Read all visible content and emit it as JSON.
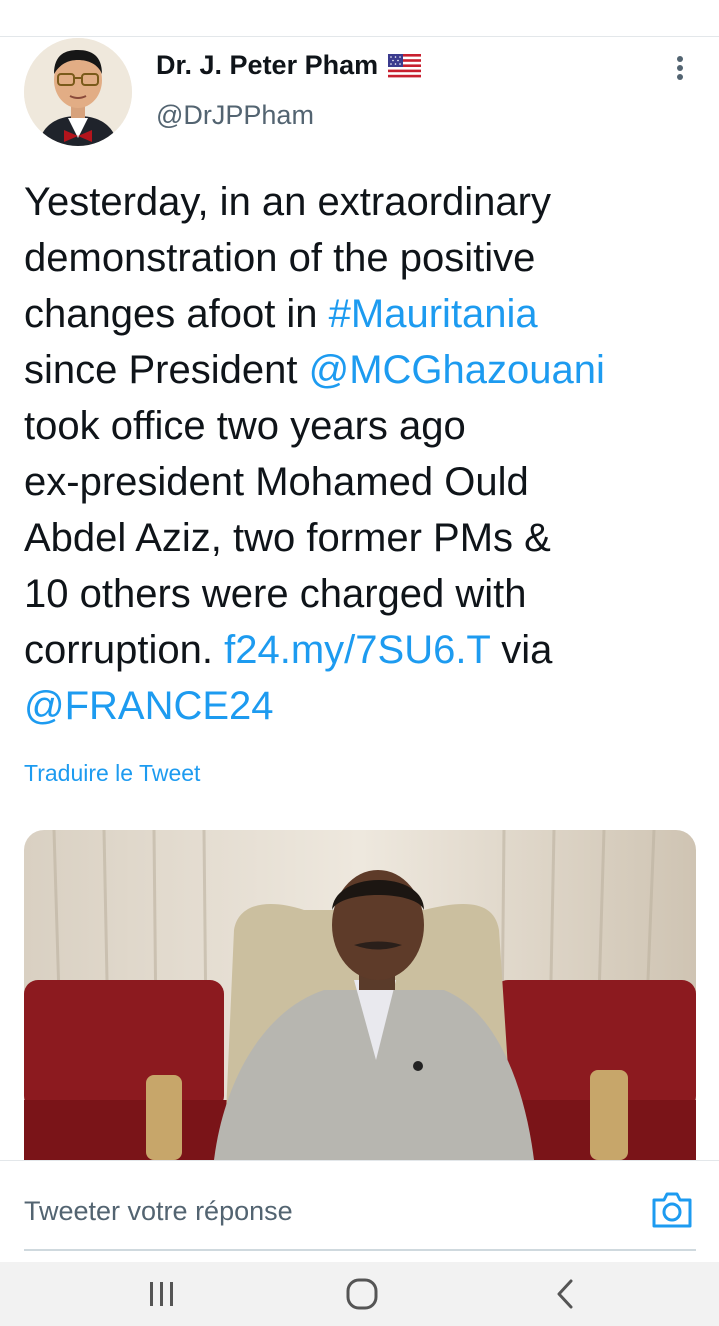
{
  "author": {
    "name": "Dr. J. Peter Pham",
    "handle": "@DrJPPham",
    "flag_icon": "us-flag-icon"
  },
  "tweet": {
    "lines": [
      [
        {
          "t": "Yesterday, in an extraordinary",
          "link": false
        }
      ],
      [
        {
          "t": "demonstration of the positive",
          "link": false
        }
      ],
      [
        {
          "t": "changes afoot in ",
          "link": false
        },
        {
          "t": "#Mauritania",
          "link": true
        }
      ],
      [
        {
          "t": "since President ",
          "link": false
        },
        {
          "t": "@MCGhazouani",
          "link": true
        }
      ],
      [
        {
          "t": "took office two years ago",
          "link": false
        }
      ],
      [
        {
          "t": "ex-president Mohamed Ould",
          "link": false
        }
      ],
      [
        {
          "t": "Abdel Aziz, two former PMs &",
          "link": false
        }
      ],
      [
        {
          "t": "10 others were charged with",
          "link": false
        }
      ],
      [
        {
          "t": "corruption. ",
          "link": false
        },
        {
          "t": "f24.my/7SU6.T",
          "link": true
        },
        {
          "t": " via",
          "link": false
        }
      ],
      [
        {
          "t": "@FRANCE24",
          "link": true
        }
      ]
    ]
  },
  "translate_label": "Traduire le Tweet",
  "reply": {
    "placeholder": "Tweeter votre réponse",
    "camera_icon": "camera-icon"
  },
  "navbar": {
    "recent_icon": "recent-apps-icon",
    "home_icon": "home-icon",
    "back_icon": "back-icon"
  },
  "colors": {
    "link": "#1d9bf0",
    "text": "#0f1419",
    "secondary": "#536471"
  }
}
